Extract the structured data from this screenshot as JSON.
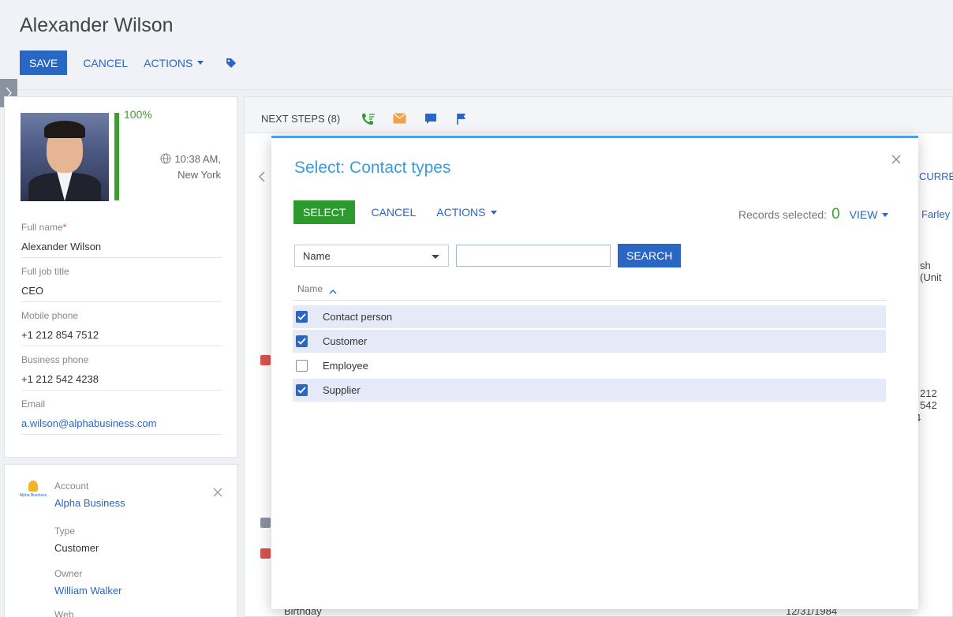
{
  "page": {
    "title": "Alexander Wilson",
    "toolbar": {
      "save": "SAVE",
      "cancel": "CANCEL",
      "actions": "ACTIONS"
    }
  },
  "profile": {
    "completeness": "100%",
    "completeness_fraction": 1.0,
    "local_time": "10:38 AM,",
    "local_city": "New York",
    "fields": [
      {
        "label": "Full name",
        "value": "Alexander Wilson",
        "required": "*"
      },
      {
        "label": "Full job title",
        "value": "CEO"
      },
      {
        "label": "Mobile phone",
        "value": "+1 212 854 7512"
      },
      {
        "label": "Business phone",
        "value": "+1 212 542 4238"
      },
      {
        "label": "Email",
        "value": "a.wilson@alphabusiness.com"
      }
    ]
  },
  "account": {
    "logo_text": "Alpha Business",
    "account_label": "Account",
    "account_value": "Alpha Business",
    "type_label": "Type",
    "type_value": "Customer",
    "owner_label": "Owner",
    "owner_value": "William Walker",
    "web_label": "Web"
  },
  "next_steps": {
    "label": "NEXT STEPS (8)"
  },
  "background": {
    "curr": "CURRE",
    "farley": "Farley",
    "lang": "sh (Unit",
    "phone_frag": "212 542",
    "frag4": "4",
    "birthday_label": "Birthday",
    "birthday_value": "12/31/1984"
  },
  "modal": {
    "title": "Select: Contact types",
    "select": "SELECT",
    "cancel": "CANCEL",
    "actions": "ACTIONS",
    "records_label": "Records selected:",
    "records_count": "0",
    "view": "VIEW",
    "filter_column": "Name",
    "filter_value": "",
    "search": "SEARCH",
    "column_header": "Name",
    "rows": [
      {
        "name": "Contact person",
        "checked": true
      },
      {
        "name": "Customer",
        "checked": true
      },
      {
        "name": "Employee",
        "checked": false
      },
      {
        "name": "Supplier",
        "checked": true
      }
    ]
  },
  "colors": {
    "primary": "#2a66c3",
    "success": "#2c9a2c",
    "modal_title": "#3d9cd6",
    "selected_row": "#e6eaf8"
  }
}
